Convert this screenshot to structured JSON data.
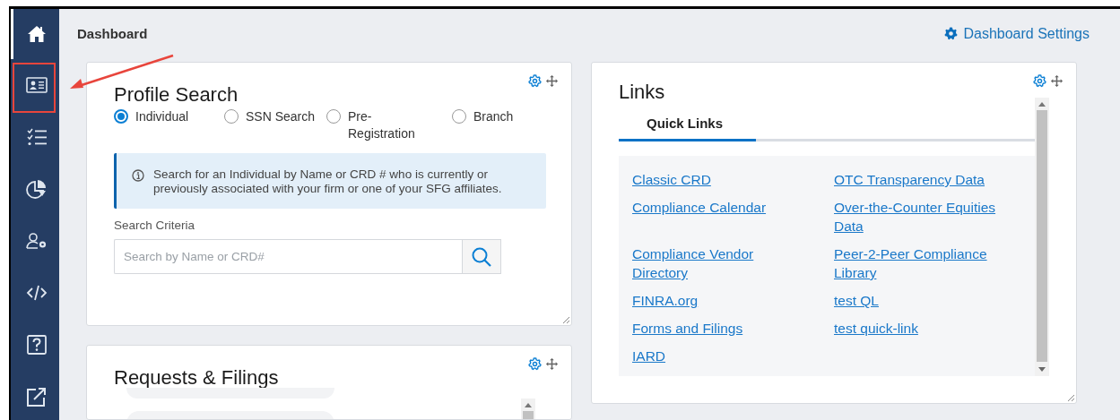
{
  "sidebar": {
    "items": [
      {
        "selected": true
      },
      {
        "selected": false
      },
      {
        "selected": false
      },
      {
        "selected": false
      },
      {
        "selected": false
      },
      {
        "selected": false
      },
      {
        "selected": false
      },
      {
        "selected": false
      }
    ]
  },
  "header": {
    "title": "Dashboard",
    "settings_link": "Dashboard Settings"
  },
  "profile_search": {
    "title": "Profile Search",
    "options": [
      {
        "label": "Individual",
        "selected": true
      },
      {
        "label": "SSN Search",
        "selected": false
      },
      {
        "label": "Pre-Registration",
        "selected": false
      },
      {
        "label": "Branch",
        "selected": false
      }
    ],
    "info": "Search for an Individual by Name or CRD # who is currently or previously associated with your firm or one of your SFG affiliates.",
    "field_label": "Search Criteria",
    "search": {
      "placeholder": "Search by Name or CRD#"
    }
  },
  "requests_filings": {
    "title": "Requests & Filings"
  },
  "links": {
    "title": "Links",
    "tabs": [
      {
        "label": "Quick Links",
        "selected": true
      }
    ],
    "items": [
      {
        "label": "Classic CRD"
      },
      {
        "label": "OTC Transparency Data"
      },
      {
        "label": "Compliance Calendar"
      },
      {
        "label": "Over-the-Counter Equities Data"
      },
      {
        "label": "Compliance Vendor Directory"
      },
      {
        "label": "Peer-2-Peer Compliance Library"
      },
      {
        "label": "FINRA.org"
      },
      {
        "label": "test QL"
      },
      {
        "label": "Forms and Filings"
      },
      {
        "label": "test quick-link"
      },
      {
        "label": "IARD"
      }
    ]
  }
}
